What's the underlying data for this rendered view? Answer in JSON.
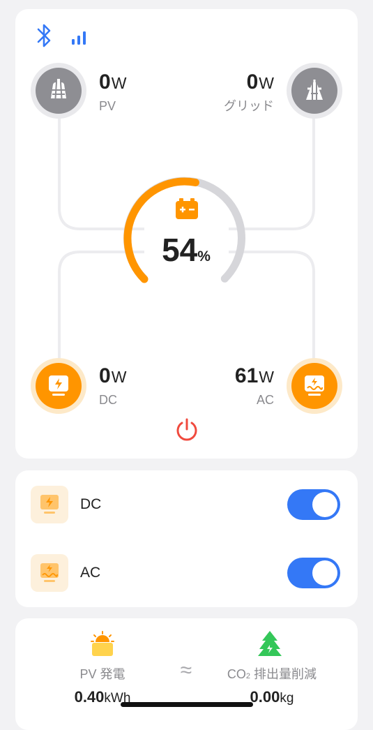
{
  "status": {
    "bluetooth_icon": "bluetooth-icon",
    "signal_icon": "signal-bars-icon"
  },
  "pv": {
    "value": "0",
    "unit": "W",
    "label": "PV"
  },
  "grid": {
    "value": "0",
    "unit": "W",
    "label": "グリッド"
  },
  "battery": {
    "percent": "54",
    "unit": "%",
    "level": 0.54
  },
  "dc": {
    "value": "0",
    "unit": "W",
    "label": "DC"
  },
  "ac": {
    "value": "61",
    "unit": "W",
    "label": "AC"
  },
  "outputs": [
    {
      "label": "DC",
      "enabled": true
    },
    {
      "label": "AC",
      "enabled": true
    }
  ],
  "stats": {
    "pv_label": "PV 発電",
    "pv_value": "0.40",
    "pv_unit": "kWh",
    "approx_symbol": "≈",
    "co2_label_prefix": "CO",
    "co2_label_sub": "2",
    "co2_label_suffix": " 排出量削減",
    "co2_value": "0.00",
    "co2_unit": "kg"
  },
  "colors": {
    "accent_blue": "#3478f6",
    "orange": "#ff9500",
    "gray_node": "#8e8e93",
    "power_red": "#f04a3e",
    "tree_green": "#34c759"
  }
}
